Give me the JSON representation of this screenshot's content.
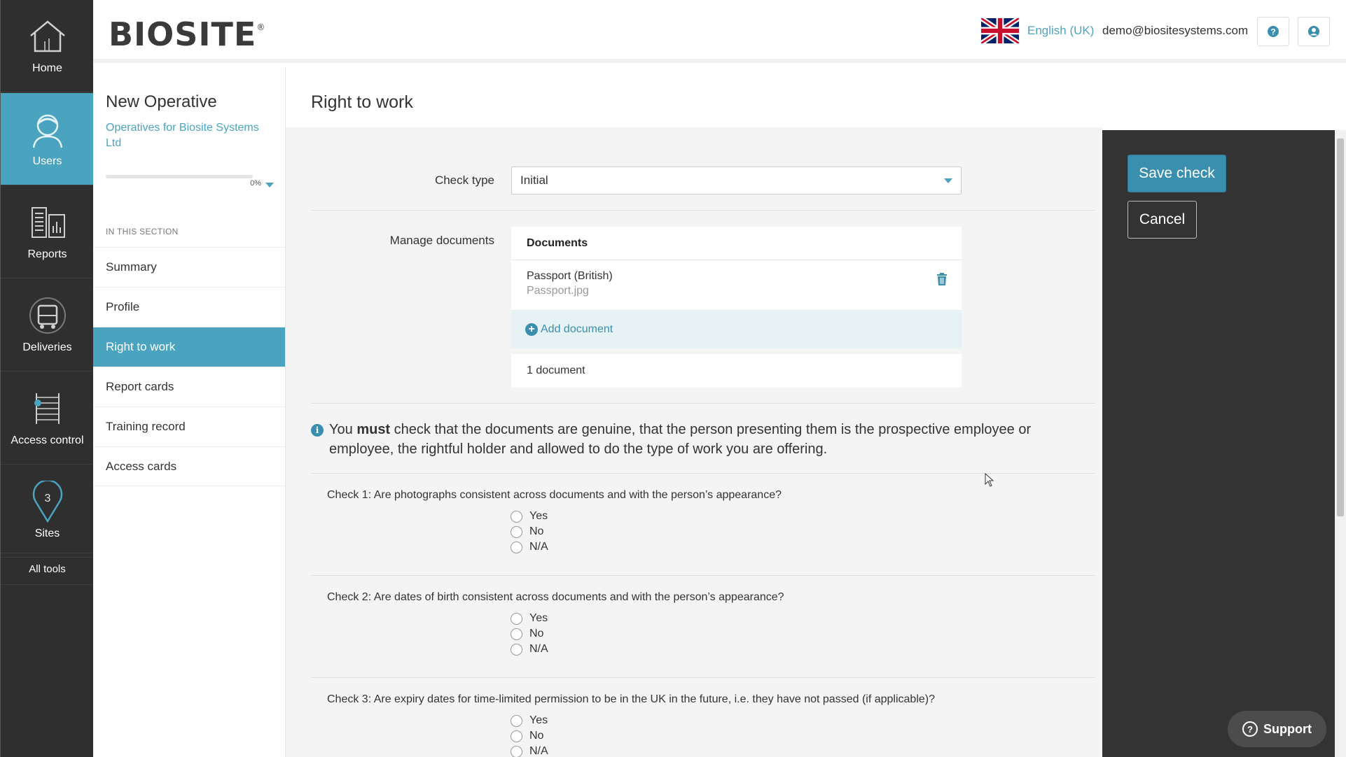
{
  "rail": {
    "items": [
      {
        "label": "Home",
        "icon": "home-icon"
      },
      {
        "label": "Users",
        "icon": "user-hardhat-icon"
      },
      {
        "label": "Reports",
        "icon": "reports-icon"
      },
      {
        "label": "Deliveries",
        "icon": "truck-icon"
      },
      {
        "label": "Access control",
        "icon": "turnstile-icon"
      },
      {
        "label": "Sites",
        "icon": "map-pin-icon"
      }
    ],
    "all_tools": "All tools",
    "active": "Users"
  },
  "header": {
    "logo": "BIOSITE",
    "logo_mark": "®",
    "language": "English (UK)",
    "email": "demo@biositesystems.com"
  },
  "sidebar": {
    "title": "New Operative",
    "subtitle": "Operatives for Biosite Systems Ltd",
    "progress": "0%",
    "progress_value": 0,
    "section_label": "IN THIS SECTION",
    "items": [
      {
        "label": "Summary"
      },
      {
        "label": "Profile"
      },
      {
        "label": "Right to work"
      },
      {
        "label": "Report cards"
      },
      {
        "label": "Training record"
      },
      {
        "label": "Access cards"
      }
    ],
    "active": "Right to work"
  },
  "main": {
    "title": "Right to work",
    "check_type_label": "Check type",
    "check_type_value": "Initial",
    "manage_documents_label": "Manage documents",
    "documents": {
      "header": "Documents",
      "items": [
        {
          "name": "Passport (British)",
          "file": "Passport.jpg"
        }
      ],
      "add_label": "Add document",
      "count": "1 document"
    },
    "notice": {
      "prefix": "You",
      "emphasis": "must",
      "text": "check that the documents are genuine, that the person presenting them is the prospective employee or employee, the rightful holder and allowed to do the type of work you are offering."
    },
    "checks": [
      {
        "question": "Check 1: Are photographs consistent across documents and with the person’s appearance?",
        "options": [
          "Yes",
          "No",
          "N/A"
        ]
      },
      {
        "question": "Check 2: Are dates of birth consistent across documents and with the person’s appearance?",
        "options": [
          "Yes",
          "No",
          "N/A"
        ]
      },
      {
        "question": "Check 3: Are expiry dates for time-limited permission to be in the UK in the future, i.e. they have not passed (if applicable)?",
        "options": [
          "Yes",
          "No",
          "N/A"
        ]
      }
    ]
  },
  "actions": {
    "save": "Save check",
    "cancel": "Cancel",
    "support": "Support"
  },
  "colors": {
    "accent": "#4aa3bf",
    "rail_bg": "#2f2f2f",
    "panel_bg": "#333333",
    "content_bg": "#f4f4f4"
  }
}
